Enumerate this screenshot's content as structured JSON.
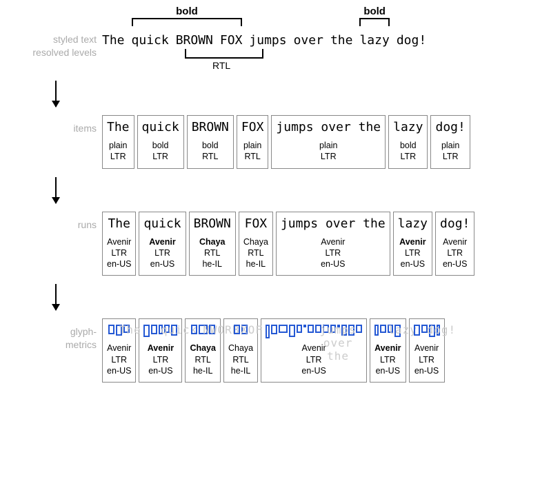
{
  "labels": {
    "styled": "styled text",
    "resolved": "resolved levels",
    "items": "items",
    "runs": "runs",
    "glyph": "glyph-\nmetrics"
  },
  "brackets": {
    "bold": "bold",
    "rtl": "RTL"
  },
  "words": {
    "w0": "The",
    "w1": "quick",
    "w2": "BROWN",
    "w3": "FOX",
    "w4": "jumps",
    "w5": "over",
    "w6": "the",
    "w7": "lazy",
    "w8": "dog!"
  },
  "items": [
    {
      "word": "The",
      "style": "plain",
      "dir": "LTR"
    },
    {
      "word": "quick",
      "style": "bold",
      "dir": "LTR"
    },
    {
      "word": "BROWN",
      "style": "bold",
      "dir": "RTL"
    },
    {
      "word": "FOX",
      "style": "plain",
      "dir": "RTL"
    },
    {
      "word": "jumps over the",
      "style": "plain",
      "dir": "LTR"
    },
    {
      "word": "lazy",
      "style": "bold",
      "dir": "LTR"
    },
    {
      "word": "dog!",
      "style": "plain",
      "dir": "LTR"
    }
  ],
  "runs": [
    {
      "word": "The",
      "font": "Avenir",
      "dir": "LTR",
      "lang": "en-US",
      "bold": false
    },
    {
      "word": "quick",
      "font": "Avenir",
      "dir": "LTR",
      "lang": "en-US",
      "bold": true
    },
    {
      "word": "BROWN",
      "font": "Chaya",
      "dir": "RTL",
      "lang": "he-IL",
      "bold": true
    },
    {
      "word": "FOX",
      "font": "Chaya",
      "dir": "RTL",
      "lang": "he-IL",
      "bold": false
    },
    {
      "word": "jumps over the",
      "font": "Avenir",
      "dir": "LTR",
      "lang": "en-US",
      "bold": false
    },
    {
      "word": "lazy",
      "font": "Avenir",
      "dir": "LTR",
      "lang": "en-US",
      "bold": true
    },
    {
      "word": "dog!",
      "font": "Avenir",
      "dir": "LTR",
      "lang": "en-US",
      "bold": false
    }
  ],
  "glyphs": [
    {
      "faint": "The",
      "g": [
        [
          9,
          14
        ],
        [
          9,
          16
        ],
        [
          9,
          12
        ]
      ],
      "font": "Avenir",
      "dir": "LTR",
      "lang": "en-US",
      "bold": false
    },
    {
      "faint": "quick",
      "g": [
        [
          9,
          18
        ],
        [
          9,
          14
        ],
        [
          6,
          14
        ],
        [
          8,
          12
        ],
        [
          9,
          16
        ]
      ],
      "font": "Avenir",
      "dir": "LTR",
      "lang": "en-US",
      "bold": true
    },
    {
      "faint": "NWORB",
      "g": [
        [
          9,
          14
        ],
        [
          13,
          14
        ],
        [
          9,
          14
        ]
      ],
      "font": "Chaya",
      "dir": "RTL",
      "lang": "he-IL",
      "bold": true
    },
    {
      "faint": "XOF",
      "g": [
        [
          9,
          14
        ],
        [
          9,
          14
        ]
      ],
      "font": "Chaya",
      "dir": "RTL",
      "lang": "he-IL",
      "bold": false
    },
    {
      "faint": "jumps over the",
      "g": [
        [
          6,
          20
        ],
        [
          9,
          14
        ],
        [
          13,
          12
        ],
        [
          9,
          18
        ],
        [
          8,
          12
        ],
        [
          4,
          4
        ],
        [
          9,
          12
        ],
        [
          9,
          12
        ],
        [
          9,
          12
        ],
        [
          8,
          12
        ],
        [
          4,
          4
        ],
        [
          8,
          16
        ],
        [
          9,
          16
        ],
        [
          9,
          12
        ]
      ],
      "font": "Avenir",
      "dir": "LTR",
      "lang": "en-US",
      "bold": false
    },
    {
      "faint": "lazy",
      "g": [
        [
          6,
          16
        ],
        [
          9,
          12
        ],
        [
          8,
          12
        ],
        [
          9,
          18
        ]
      ],
      "font": "Avenir",
      "dir": "LTR",
      "lang": "en-US",
      "bold": true
    },
    {
      "faint": "dog!",
      "g": [
        [
          9,
          16
        ],
        [
          9,
          12
        ],
        [
          9,
          18
        ],
        [
          5,
          16
        ]
      ],
      "font": "Avenir",
      "dir": "LTR",
      "lang": "en-US",
      "bold": false
    }
  ]
}
